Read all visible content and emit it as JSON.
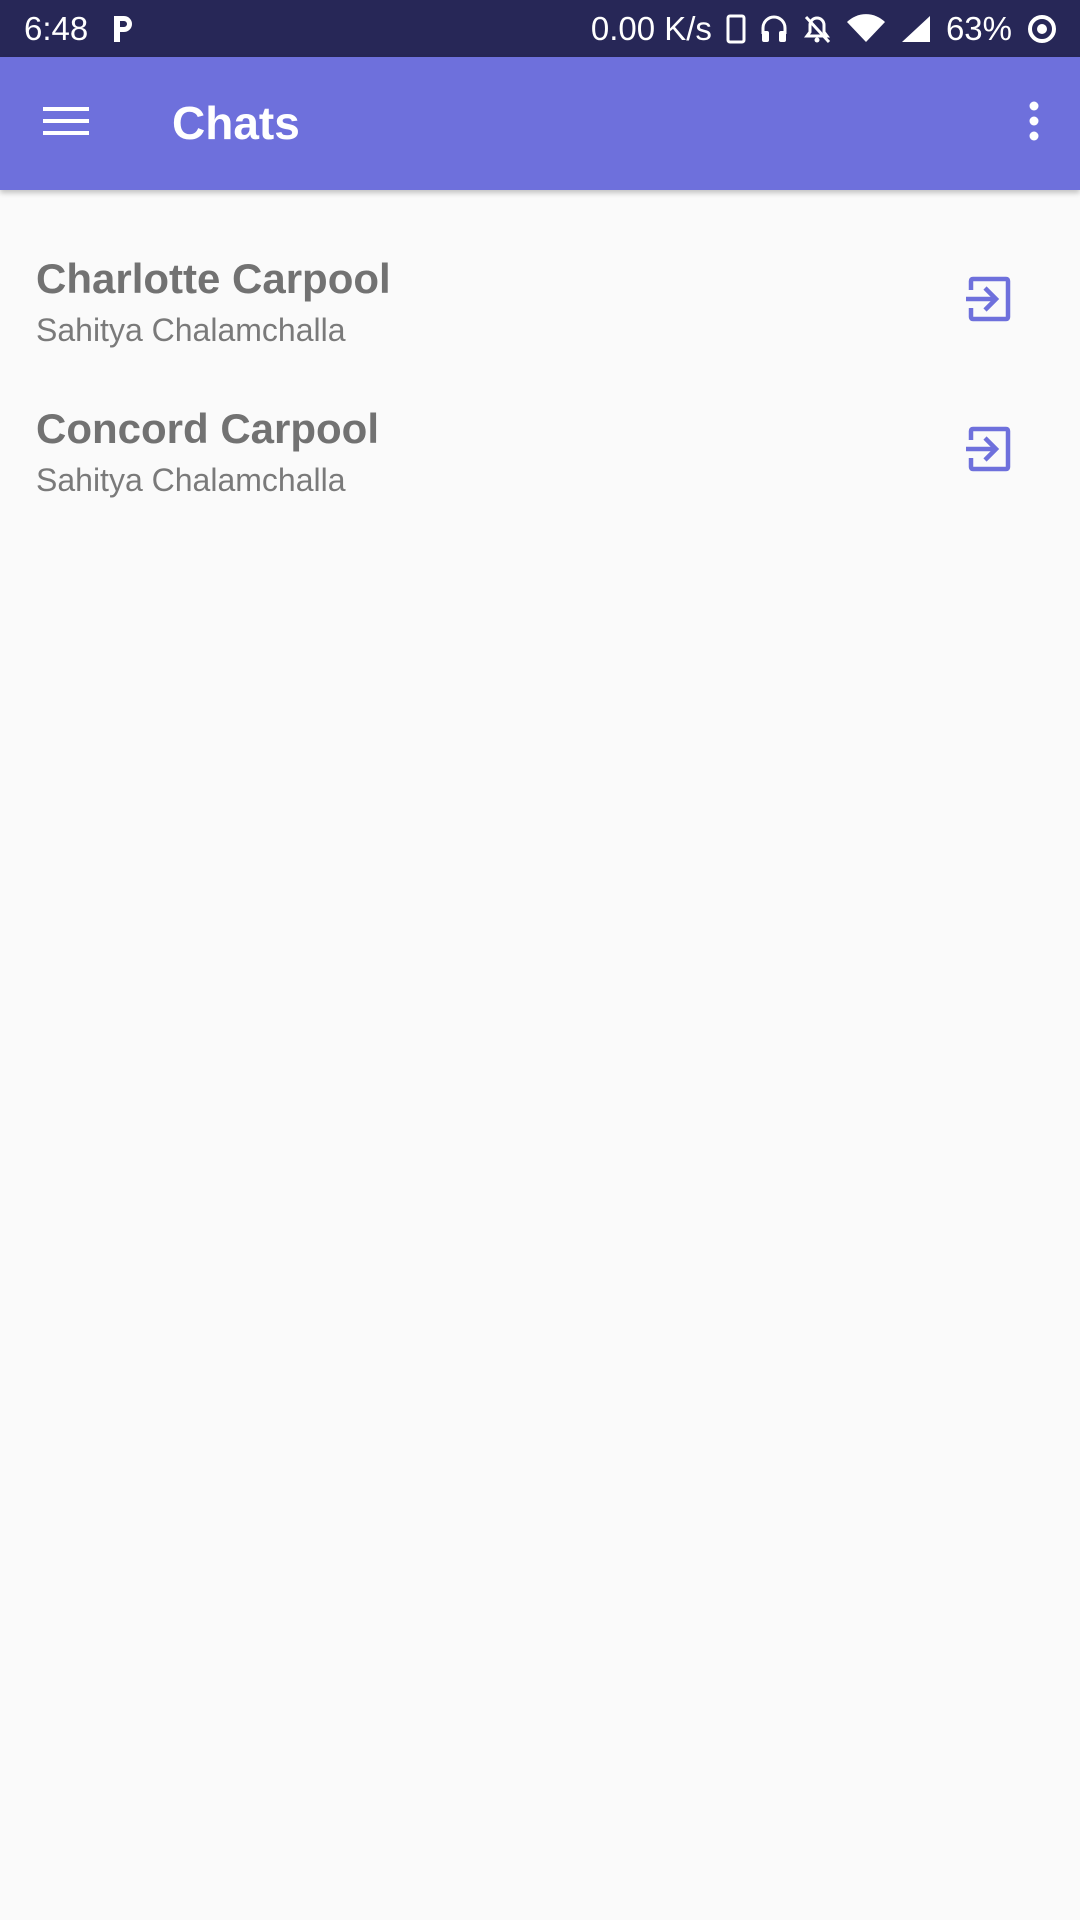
{
  "status_bar": {
    "time": "6:48",
    "network_speed": "0.00 K/s",
    "battery": "63%",
    "icons": [
      "parking-app-icon",
      "phone-icon",
      "headphones-icon",
      "bell-off-icon",
      "wifi-icon",
      "signal-icon",
      "battery-ring-icon"
    ]
  },
  "app_bar": {
    "title": "Chats",
    "menu_icon": "hamburger-menu-icon",
    "overflow_icon": "more-vert-icon"
  },
  "chats": [
    {
      "name": "Charlotte Carpool",
      "subtitle": "Sahitya Chalamchalla",
      "action_icon": "enter-icon"
    },
    {
      "name": "Concord Carpool",
      "subtitle": "Sahitya Chalamchalla",
      "action_icon": "enter-icon"
    }
  ],
  "colors": {
    "status_bar": "#272757",
    "app_bar": "#6e70dc",
    "accent_icon": "#6e70dc",
    "background": "#fafafa",
    "text_primary": "#727272"
  }
}
